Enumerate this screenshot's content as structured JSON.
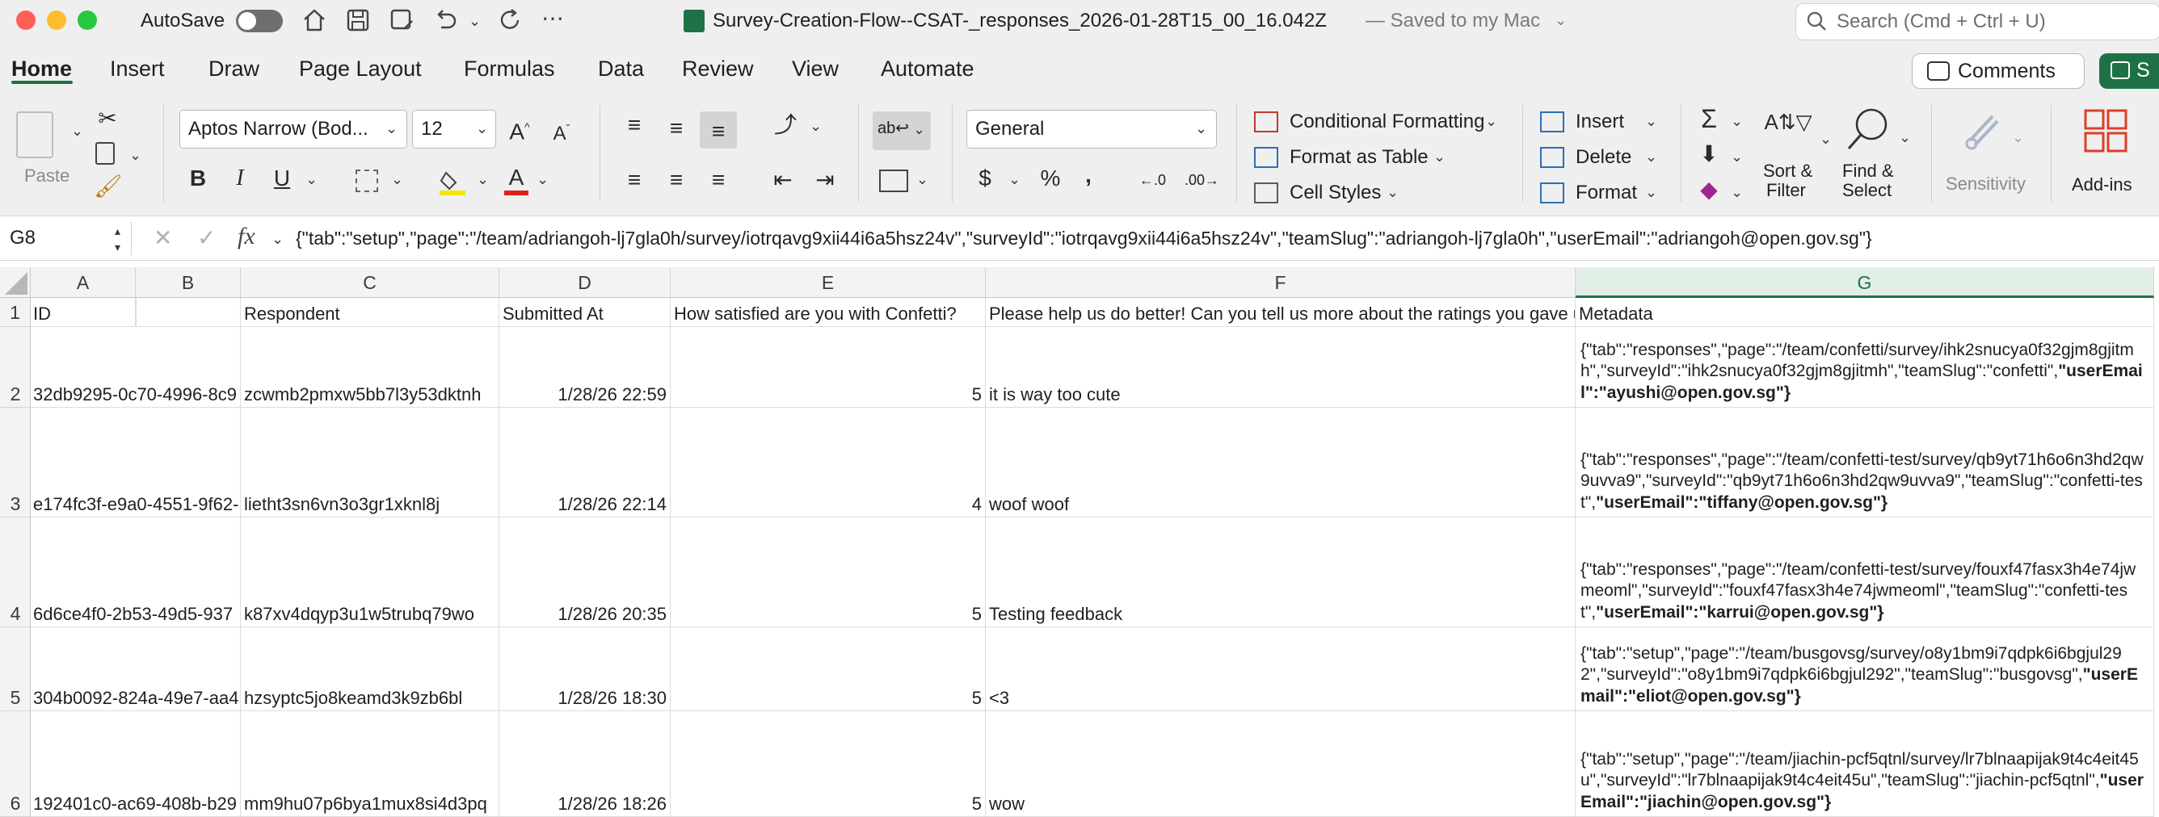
{
  "titlebar": {
    "autosave_label": "AutoSave",
    "file_name": "Survey-Creation-Flow--CSAT-_responses_2026-01-28T15_00_16.042Z",
    "save_status": "— Saved to my Mac",
    "search_placeholder": "Search (Cmd + Ctrl + U)"
  },
  "ribbon_tabs": [
    "Home",
    "Insert",
    "Draw",
    "Page Layout",
    "Formulas",
    "Data",
    "Review",
    "View",
    "Automate"
  ],
  "ribbon_buttons": {
    "comments": "Comments",
    "share": "S",
    "paste": "Paste",
    "font_name": "Aptos Narrow (Bod...",
    "font_size": "12",
    "number_format": "General",
    "conditional_formatting": "Conditional Formatting",
    "format_as_table": "Format as Table",
    "cell_styles": "Cell Styles",
    "insert": "Insert",
    "delete": "Delete",
    "format": "Format",
    "sort_filter_1": "Sort &",
    "sort_filter_2": "Filter",
    "find_select_1": "Find &",
    "find_select_2": "Select",
    "sensitivity": "Sensitivity",
    "add_ins": "Add-ins",
    "bold": "B",
    "italic": "I",
    "underline": "U",
    "percent": "%",
    "comma": ",",
    "currency": "$"
  },
  "formula_bar": {
    "name_box": "G8",
    "fx": "fx",
    "content": "{\"tab\":\"setup\",\"page\":\"/team/adriangoh-lj7gla0h/survey/iotrqavg9xii44i6a5hsz24v\",\"surveyId\":\"iotrqavg9xii44i6a5hsz24v\",\"teamSlug\":\"adriangoh-lj7gla0h\",\"userEmail\":\"adriangoh@open.gov.sg\"}"
  },
  "columns": [
    "A",
    "B",
    "C",
    "D",
    "E",
    "F",
    "G"
  ],
  "header_row": {
    "row": "1",
    "cells": [
      "ID",
      "",
      "Respondent",
      "Submitted At",
      "How satisfied are you with Confetti?",
      "Please help us do better! Can you tell us more about the ratings you gave us?",
      "Metadata"
    ]
  },
  "rows": [
    {
      "row": "2",
      "id": "32db9295-0c70-4996-8c9",
      "respondent": "zcwmb2pmxw5bb7l3y53dktnh",
      "submitted": "1/28/26 22:59",
      "rating": "5",
      "feedback": "it is way too cute",
      "meta_plain": "{\"tab\":\"responses\",\"page\":\"/team/confetti/survey/ihk2snucya0f32gjm8gjitmh\",\"surveyId\":\"ihk2snucya0f32gjm8gjitmh\",\"teamSlug\":\"confetti\",",
      "meta_bold": "\"userEmail\":\"ayushi@open.gov.sg\"}"
    },
    {
      "row": "3",
      "id": "e174fc3f-e9a0-4551-9f62-",
      "respondent": "lietht3sn6vn3o3gr1xknl8j",
      "submitted": "1/28/26 22:14",
      "rating": "4",
      "feedback": "woof woof",
      "meta_plain": "{\"tab\":\"responses\",\"page\":\"/team/confetti-test/survey/qb9yt71h6o6n3hd2qw9uvva9\",\"surveyId\":\"qb9yt71h6o6n3hd2qw9uvva9\",\"teamSlug\":\"confetti-test\",",
      "meta_bold": "\"userEmail\":\"tiffany@open.gov.sg\"}"
    },
    {
      "row": "4",
      "id": "6d6ce4f0-2b53-49d5-937",
      "respondent": "k87xv4dqyp3u1w5trubq79wo",
      "submitted": "1/28/26 20:35",
      "rating": "5",
      "feedback": "Testing feedback",
      "meta_plain": "{\"tab\":\"responses\",\"page\":\"/team/confetti-test/survey/fouxf47fasx3h4e74jwmeoml\",\"surveyId\":\"fouxf47fasx3h4e74jwmeoml\",\"teamSlug\":\"confetti-test\",",
      "meta_bold": "\"userEmail\":\"karrui@open.gov.sg\"}"
    },
    {
      "row": "5",
      "id": "304b0092-824a-49e7-aa4",
      "respondent": "hzsyptc5jo8keamd3k9zb6bl",
      "submitted": "1/28/26 18:30",
      "rating": "5",
      "feedback": "<3",
      "meta_plain": "{\"tab\":\"setup\",\"page\":\"/team/busgovsg/survey/o8y1bm9i7qdpk6i6bgjul292\",\"surveyId\":\"o8y1bm9i7qdpk6i6bgjul292\",\"teamSlug\":\"busgovsg\",",
      "meta_bold": "\"userEmail\":\"eliot@open.gov.sg\"}"
    },
    {
      "row": "6",
      "id": "192401c0-ac69-408b-b29",
      "respondent": "mm9hu07p6bya1mux8si4d3pq",
      "submitted": "1/28/26 18:26",
      "rating": "5",
      "feedback": "wow",
      "meta_plain": "{\"tab\":\"setup\",\"page\":\"/team/jiachin-pcf5qtnl/survey/lr7blnaapijak9t4c4eit45u\",\"surveyId\":\"lr7blnaapijak9t4c4eit45u\",\"teamSlug\":\"jiachin-pcf5qtnl\",",
      "meta_bold": "\"userEmail\":\"jiachin@open.gov.sg\"}"
    }
  ],
  "colors": {
    "accent": "#1e7145",
    "selected_header": "#e2efe6"
  }
}
